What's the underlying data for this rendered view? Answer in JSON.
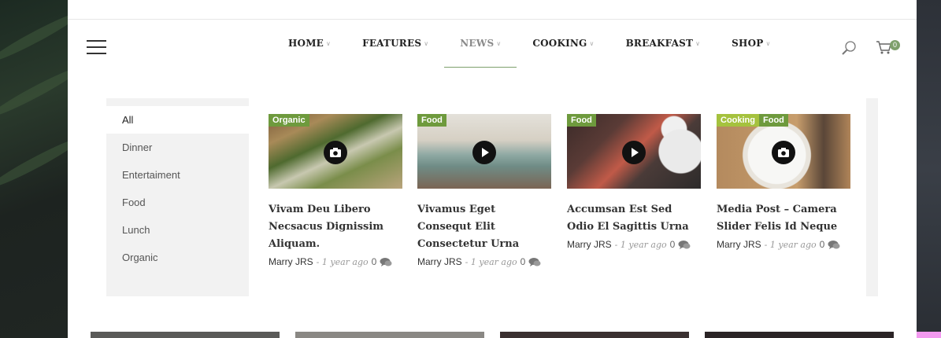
{
  "nav": {
    "items": [
      {
        "label": "HOME",
        "active": false
      },
      {
        "label": "FEATURES",
        "active": false
      },
      {
        "label": "NEWS",
        "active": true
      },
      {
        "label": "COOKING",
        "active": false
      },
      {
        "label": "BREAKFAST",
        "active": false
      },
      {
        "label": "SHOP",
        "active": false
      }
    ],
    "cart_count": "0"
  },
  "categories": [
    "All",
    "Dinner",
    "Entertaiment",
    "Food",
    "Lunch",
    "Organic"
  ],
  "posts": [
    {
      "tags": [
        "Organic"
      ],
      "title": "Vivam Deu Libero Necsacus Dignissim Aliquam.",
      "author": "Marry JRS",
      "date": "- 1 year ago",
      "comments": "0",
      "media": "camera-icon"
    },
    {
      "tags": [
        "Food"
      ],
      "title": "Vivamus Eget Consequt Elit Consectetur Urna",
      "author": "Marry JRS",
      "date": "- 1 year ago",
      "comments": "0",
      "media": "play-icon"
    },
    {
      "tags": [
        "Food"
      ],
      "title": "Accumsan Est Sed Odio El Sagittis Urna",
      "author": "Marry JRS",
      "date": "- 1 year ago",
      "comments": "0",
      "media": "play-icon"
    },
    {
      "tags": [
        "Cooking",
        "Food"
      ],
      "title": "Media Post – Camera Slider Felis Id Neque",
      "author": "Marry JRS",
      "date": "- 1 year ago",
      "comments": "0",
      "media": "camera-icon"
    }
  ],
  "colors": {
    "accent": "#7ea06c",
    "tag_green": "#6e9a3d",
    "tag_lime": "#a5c23e"
  }
}
